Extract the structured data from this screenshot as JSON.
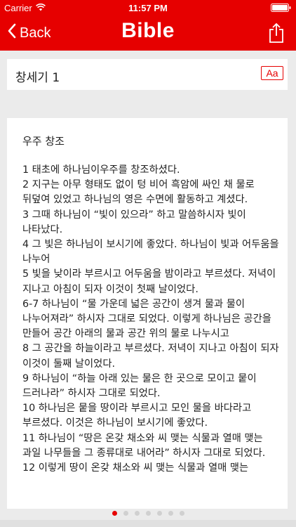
{
  "status_bar": {
    "carrier": "Carrier",
    "time": "11:57 PM"
  },
  "nav": {
    "back_label": "Back",
    "title": "Bible"
  },
  "chapter": {
    "title": "창세기 1",
    "font_button": "Aa"
  },
  "text": {
    "heading": "우주 창조",
    "verses": [
      "1 태초에 하나님이우주를 창조하셨다.",
      "2 지구는 아무 형태도 없이 텅 비어 흑암에 싸인 채 물로 뒤덮여 있었고 하나님의 영은 수면에 활동하고 계셨다.",
      "3 그때 하나님이 “빛이 있으라” 하고 말씀하시자 빛이 나타났다.",
      "4 그 빛은 하나님이 보시기에 좋았다. 하나님이 빛과 어두움을 나누어",
      "5 빛을 낮이라 부르시고 어두움을 밤이라고 부르셨다. 저녁이 지나고 아침이 되자 이것이 첫째 날이었다.",
      "6-7 하나님이 “물 가운데 넓은 공간이 생겨 물과 물이 나누어져라” 하시자 그대로 되었다. 이렇게 하나님은 공간을 만들어 공간 아래의 물과 공간 위의 물로 나누시고",
      "8 그 공간을 하늘이라고 부르셨다. 저녁이 지나고 아침이 되자 이것이 둘째 날이었다.",
      "9 하나님이 “하늘 아래 있는 물은 한 곳으로 모이고 뭍이 드러나라” 하시자 그대로 되었다.",
      "10 하나님은 뭍을 땅이라 부르시고 모인 물을 바다라고 부르셨다. 이것은 하나님이 보시기에 좋았다.",
      "11 하나님이 “땅은 온갖 채소와 씨 맺는 식물과 열매 맺는 과일 나무들을 그 종류대로 내어라” 하시자 그대로 되었다.",
      "12 이렇게 땅이 온갖 채소와 씨 맺는 식물과 열매 맺는"
    ]
  },
  "pagination": {
    "count": 7,
    "active_index": 0
  },
  "colors": {
    "brand_red": "#e60000",
    "background": "#ebebeb",
    "card": "#ffffff",
    "inactive_dot": "#d0d0d0"
  },
  "icons": {
    "wifi": "wifi-icon",
    "battery": "battery-icon",
    "back": "chevron-left-icon",
    "share": "share-icon"
  }
}
